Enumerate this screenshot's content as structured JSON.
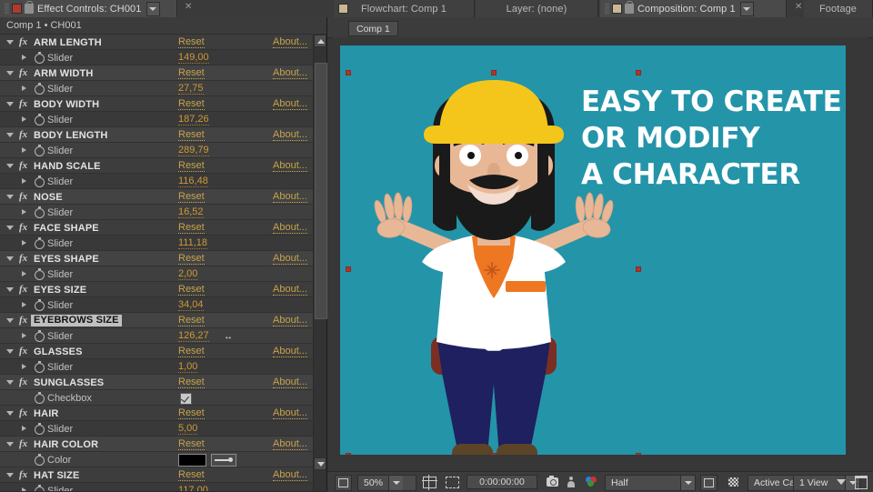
{
  "top_tabs": [
    {
      "label": "Effect Controls: CH001",
      "state": "active",
      "icon": "red-swatch",
      "has_lock": true,
      "has_menu": true,
      "has_close": true
    },
    {
      "label": "Flowchart: Comp 1",
      "state": "inactive",
      "icon": "tan-swatch",
      "has_lock": false,
      "has_menu": false,
      "has_close": false
    },
    {
      "label": "Layer: (none)",
      "state": "inactive",
      "icon": "none",
      "has_lock": false,
      "has_menu": false,
      "has_close": false
    },
    {
      "label": "Composition: Comp 1",
      "state": "active",
      "icon": "tan-swatch",
      "has_lock": true,
      "has_menu": true,
      "has_close": true
    },
    {
      "label": "Footage",
      "state": "inactive",
      "icon": "none",
      "has_lock": false,
      "has_menu": false,
      "has_close": false
    }
  ],
  "effect_controls": {
    "breadcrumb": "Comp 1 • CH001",
    "reset_label": "Reset",
    "about_label": "About...",
    "effects": [
      {
        "name": "ARM LENGTH",
        "param": "Slider",
        "value": "149,00",
        "type": "slider"
      },
      {
        "name": "ARM WIDTH",
        "param": "Slider",
        "value": "27,75",
        "type": "slider"
      },
      {
        "name": "BODY WIDTH",
        "param": "Slider",
        "value": "187,26",
        "type": "slider"
      },
      {
        "name": "BODY LENGTH",
        "param": "Slider",
        "value": "289,79",
        "type": "slider"
      },
      {
        "name": "HAND SCALE",
        "param": "Slider",
        "value": "116,48",
        "type": "slider"
      },
      {
        "name": "NOSE",
        "param": "Slider",
        "value": "16,52",
        "type": "slider"
      },
      {
        "name": "FACE SHAPE",
        "param": "Slider",
        "value": "111,18",
        "type": "slider"
      },
      {
        "name": "EYES SHAPE",
        "param": "Slider",
        "value": "2,00",
        "type": "slider"
      },
      {
        "name": "EYES SIZE",
        "param": "Slider",
        "value": "34,04",
        "type": "slider"
      },
      {
        "name": "EYEBROWS SIZE",
        "param": "Slider",
        "value": "126,27",
        "type": "slider",
        "selected": true
      },
      {
        "name": "GLASSES",
        "param": "Slider",
        "value": "1,00",
        "type": "slider"
      },
      {
        "name": "SUNGLASSES",
        "param": "Checkbox",
        "value": "checked",
        "type": "checkbox"
      },
      {
        "name": "HAIR",
        "param": "Slider",
        "value": "5,00",
        "type": "slider"
      },
      {
        "name": "HAIR COLOR",
        "param": "Color",
        "value": "#000000",
        "type": "color"
      },
      {
        "name": "HAT SIZE",
        "param": "Slider",
        "value": "117,00",
        "type": "slider"
      }
    ]
  },
  "composition": {
    "tab_label": "Comp 1",
    "canvas_bg": "#2494a9",
    "headline": [
      "EASY TO CREATE",
      "OR MODIFY",
      "A CHARACTER"
    ],
    "headline_color": "#ffffff",
    "selection_handle_color": "#b1342a"
  },
  "bottom_toolbar": {
    "zoom": "50%",
    "timecode": "0:00:00:00",
    "resolution": "Half",
    "camera": "Active Camera",
    "views": "1 View",
    "icons": [
      "always-preview-icon",
      "region-of-interest-icon",
      "mask-outline-icon",
      "snapshot-icon",
      "show-snapshot-icon",
      "channel-icon",
      "transparency-grid-icon",
      "toggle-mask-icon",
      "timeline-icon",
      "comp-flowchart-icon"
    ]
  },
  "character": {
    "hat_color": "#f4c61c",
    "hair_color": "#1a1a1a",
    "skin_color": "#e8b896",
    "shirt_color": "#ffffff",
    "undershirt_color": "#ee7722",
    "belt_color": "#7a2f22",
    "pants_color": "#1e2060",
    "shoe_color": "#5c4428"
  }
}
